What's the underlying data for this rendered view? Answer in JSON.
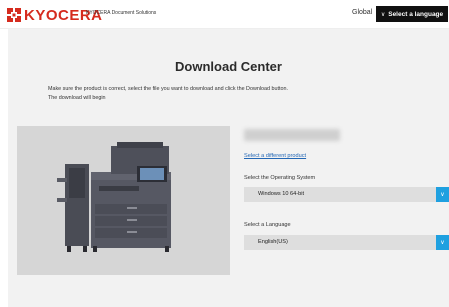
{
  "header": {
    "brand": "KYOCERA",
    "tagline": "KYOCERA Document Solutions",
    "global_label": "Global",
    "language_button": "Select a language",
    "language_button_icon": "chevron-down-icon"
  },
  "main": {
    "title": "Download Center",
    "description_line1": "Make sure the product is correct, select the file you want to download and click the Download button.",
    "description_line2": "The download will begin",
    "product_image_alt": "multifunction-printer-image",
    "change_product_link": "Select a different product",
    "os_label": "Select the Operating System",
    "os_value": "Windows 10 64-bit",
    "language_label": "Select a Language",
    "language_value": "English(US)"
  },
  "colors": {
    "brand_red": "#d52b1e",
    "accent_blue": "#1fa0e0",
    "link_blue": "#2367b5",
    "header_button_bg": "#111111",
    "panel_bg": "#f2f2f2"
  }
}
